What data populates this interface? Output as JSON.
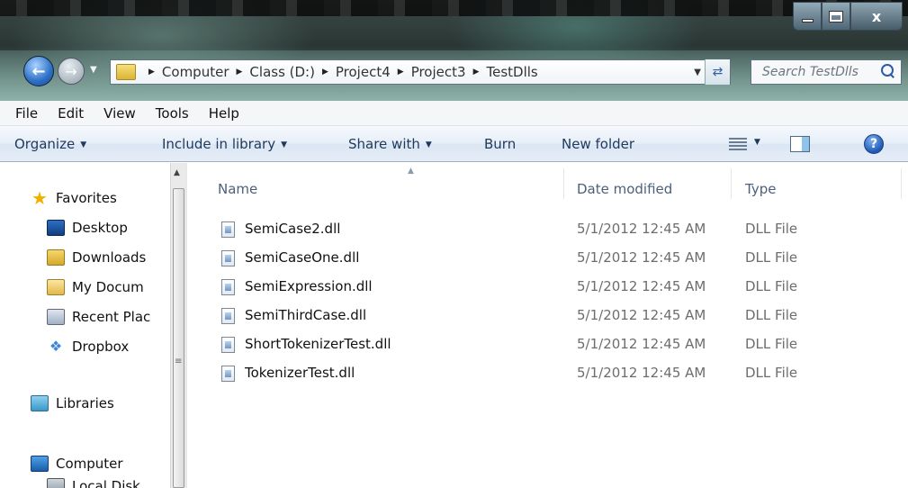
{
  "window": {
    "minimize_icon": "minimize-icon",
    "maximize_icon": "maximize-icon",
    "close_label": "x"
  },
  "address": {
    "crumbs": [
      "Computer",
      "Class (D:)",
      "Project4",
      "Project3",
      "TestDlls"
    ]
  },
  "search": {
    "placeholder": "Search TestDlls"
  },
  "menubar": {
    "items": [
      "File",
      "Edit",
      "View",
      "Tools",
      "Help"
    ]
  },
  "toolbar": {
    "organize": "Organize",
    "include_in_library": "Include in library",
    "share_with": "Share with",
    "burn": "Burn",
    "new_folder": "New folder",
    "help": "?"
  },
  "navigation": {
    "favorites": "Favorites",
    "items": [
      "Desktop",
      "Downloads",
      "My Docum",
      "Recent Plac",
      "Dropbox"
    ],
    "libraries": "Libraries",
    "computer": "Computer",
    "local_disk": "Local Disk"
  },
  "columns": {
    "name": "Name",
    "date_modified": "Date modified",
    "type": "Type"
  },
  "files": [
    {
      "name": "SemiCase2.dll",
      "date": "5/1/2012 12:45 AM",
      "type": "DLL File"
    },
    {
      "name": "SemiCaseOne.dll",
      "date": "5/1/2012 12:45 AM",
      "type": "DLL File"
    },
    {
      "name": "SemiExpression.dll",
      "date": "5/1/2012 12:45 AM",
      "type": "DLL File"
    },
    {
      "name": "SemiThirdCase.dll",
      "date": "5/1/2012 12:45 AM",
      "type": "DLL File"
    },
    {
      "name": "ShortTokenizerTest.dll",
      "date": "5/1/2012 12:45 AM",
      "type": "DLL File"
    },
    {
      "name": "TokenizerTest.dll",
      "date": "5/1/2012 12:45 AM",
      "type": "DLL File"
    }
  ]
}
